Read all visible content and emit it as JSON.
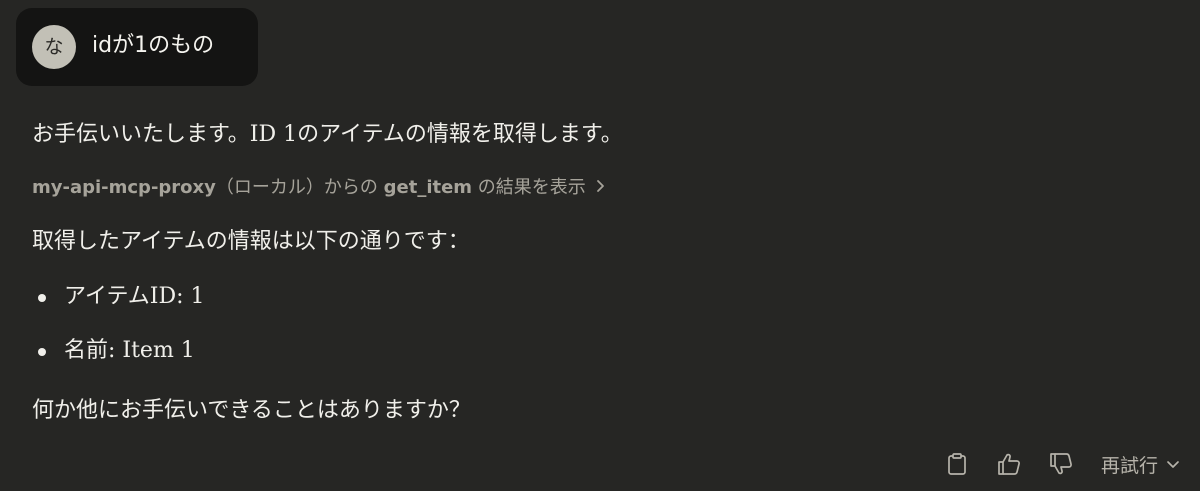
{
  "user_message": {
    "avatar_initial": "な",
    "text": "idが1のもの"
  },
  "assistant": {
    "intro": "お手伝いいたします。ID 1のアイテムの情報を取得します。",
    "tool_call": {
      "server": "my-api-mcp-proxy",
      "scope": "（ローカル）からの",
      "tool_name": "get_item",
      "suffix": "の結果を表示"
    },
    "result_intro": "取得したアイテムの情報は以下の通りです：",
    "items": [
      {
        "text": "アイテムID: 1"
      },
      {
        "text": "名前: Item 1"
      }
    ],
    "closing": "何か他にお手伝いできることはありますか？"
  },
  "actions": {
    "copy_icon": "clipboard-icon",
    "like_icon": "thumbs-up-icon",
    "dislike_icon": "thumbs-down-icon",
    "retry_label": "再試行"
  },
  "colors": {
    "background": "#262624",
    "user_bubble": "#141413",
    "avatar": "#c2c0b6",
    "muted_text": "#a6a39a"
  }
}
